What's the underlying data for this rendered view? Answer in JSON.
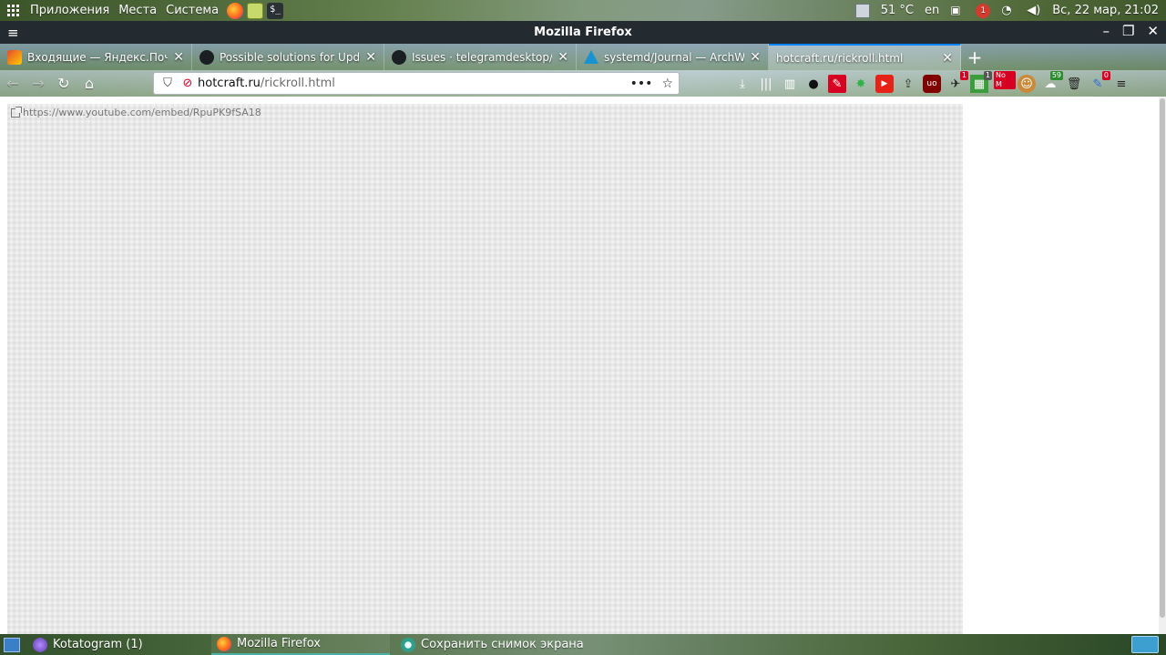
{
  "top_panel": {
    "menus": [
      "Приложения",
      "Места",
      "Система"
    ],
    "temperature": "51 °C",
    "keyboard_layout": "en",
    "notifications_count": "1",
    "clock": "Вс, 22 мар, 21:02"
  },
  "window": {
    "title": "Mozilla Firefox"
  },
  "tabs": [
    {
      "label": "Входящие — Яндекс.Почта",
      "icon": "mail-icon",
      "active": false
    },
    {
      "label": "Possible solutions for Upd",
      "icon": "github-icon",
      "active": false
    },
    {
      "label": "Issues · telegramdesktop/",
      "icon": "github-icon",
      "active": false
    },
    {
      "label": "systemd/Journal — ArchWi",
      "icon": "arch-icon",
      "active": false
    },
    {
      "label": "hotcraft.ru/rickroll.html",
      "icon": "none",
      "active": true
    }
  ],
  "urlbar": {
    "host": "hotcraft.ru",
    "path": "/rickroll.html"
  },
  "toolbar_badges": {
    "ext1": "1",
    "ext2": "1",
    "ext3": "No M",
    "ext4": "59",
    "ext5": "0"
  },
  "page": {
    "iframe_link": "https://www.youtube.com/embed/RpuPK9fSA18"
  },
  "taskbar": {
    "tasks": [
      {
        "label": "Kotatogram (1)",
        "icon": "kotatogram-icon"
      },
      {
        "label": "Mozilla Firefox",
        "icon": "firefox-icon"
      },
      {
        "label": "Сохранить снимок экрана",
        "icon": "screenshot-icon"
      }
    ]
  },
  "colors": {
    "titlebar": "#232a30",
    "active_tab_accent": "#0a84ff",
    "insecure_icon": "#d70022"
  }
}
